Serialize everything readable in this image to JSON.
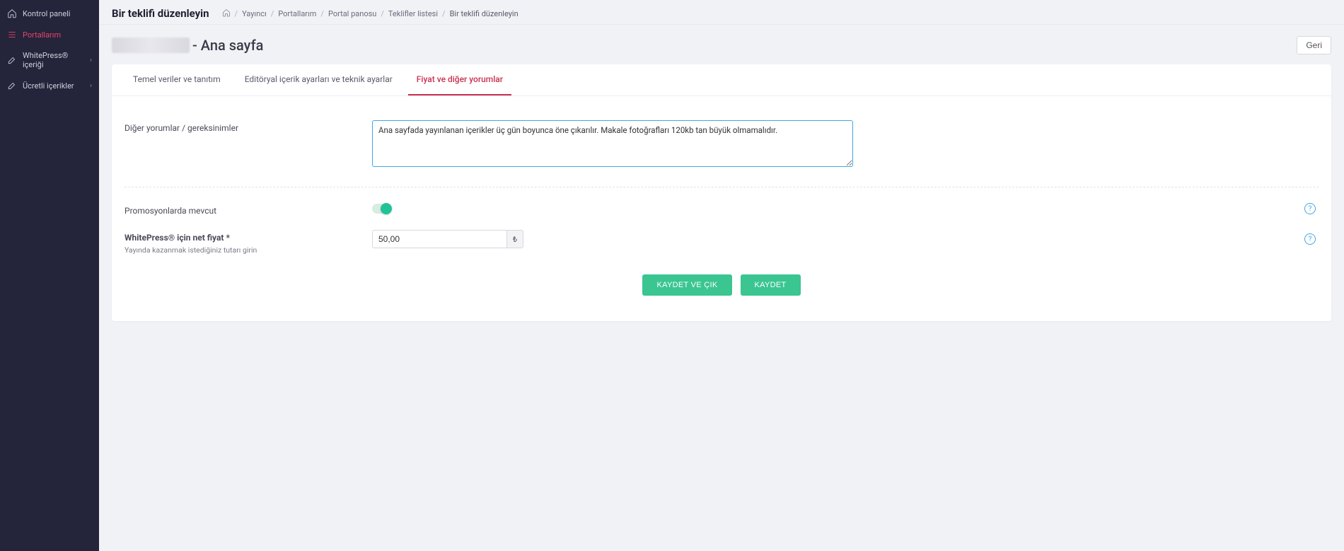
{
  "sidebar": {
    "items": [
      {
        "label": "Kontrol paneli",
        "icon": "home",
        "has_chevron": false,
        "active": false
      },
      {
        "label": "Portallarım",
        "icon": "list",
        "has_chevron": false,
        "active": true
      },
      {
        "label": "WhitePress® içeriği",
        "icon": "edit",
        "has_chevron": true,
        "active": false
      },
      {
        "label": "Ücretli içerikler",
        "icon": "edit",
        "has_chevron": true,
        "active": false
      }
    ]
  },
  "header": {
    "page_title": "Bir teklifi düzenleyin",
    "breadcrumb": [
      "Yayıncı",
      "Portallarım",
      "Portal panosu",
      "Teklifler listesi",
      "Bir teklifi düzenleyin"
    ]
  },
  "site": {
    "title_suffix": " - Ana sayfa",
    "back_label": "Geri"
  },
  "tabs": [
    {
      "label": "Temel veriler ve tanıtım",
      "active": false
    },
    {
      "label": "Editöryal içerik ayarları ve teknik ayarlar",
      "active": false
    },
    {
      "label": "Fiyat ve diğer yorumlar",
      "active": true
    }
  ],
  "form": {
    "comments_label": "Diğer yorumlar / gereksinimler",
    "comments_value": "Ana sayfada yayınlanan içerikler üç gün boyunca öne çıkarılır. Makale fotoğrafları 120kb tan büyük olmamalıdır.",
    "promo_label": "Promosyonlarda mevcut",
    "promo_on": true,
    "price_label": "WhitePress® için net fiyat *",
    "price_hint": "Yayında kazanmak istediğiniz tutarı girin",
    "price_value": "50,00",
    "currency_symbol": "₺"
  },
  "actions": {
    "save_exit": "KAYDET VE ÇIK",
    "save": "KAYDET"
  }
}
